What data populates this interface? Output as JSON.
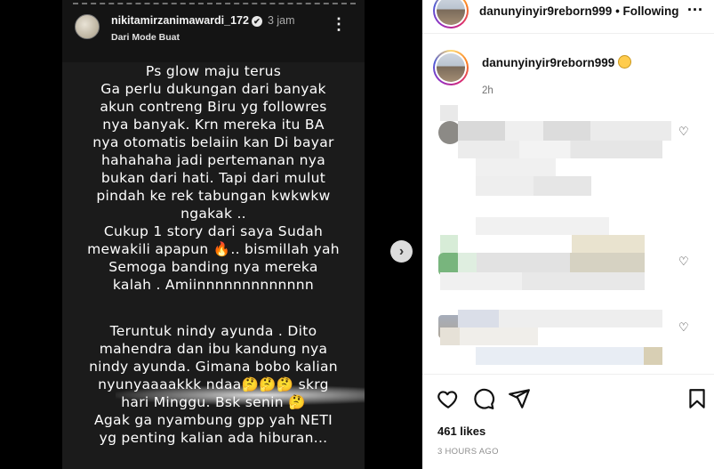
{
  "story": {
    "username": "nikitamirzanimawardi_172",
    "verified_mark": "✔",
    "time": "3 jam",
    "subtitle": "Dari Mode Buat",
    "more_icon": "more-vertical-icon",
    "text_block_1": "Ps glow maju terus\nGa perlu dukungan dari banyak\nakun contreng Biru yg followres\nnya banyak. Krn mereka itu BA\nnya otomatis belaiin kan Di bayar\nhahahaha jadi pertemanan nya\nbukan dari hati. Tapi dari mulut\npindah ke rek tabungan kwkwkw\nngakak ..\nCukup 1 story dari saya Sudah\nmewakili apapun 🔥.. bismillah yah\nSemoga banding nya mereka\nkalah . Amiinnnnnnnnnnnnn",
    "text_block_2": "Teruntuk nindy ayunda . Dito\nmahendra dan ibu kandung nya\nnindy ayunda. Gimana bobo kalian\nnyunyaaaakkk ndaa🤔🤔🤔 skrg\nhari Minggu. Bsk senin 🤔\nAgak ga nyambung gpp yah NETI\nyg penting kalian ada hiburan...",
    "next_icon": "chevron-right-icon",
    "next_glyph": "›"
  },
  "post": {
    "header": {
      "username": "danunyinyir9reborn999",
      "separator": " • ",
      "following_label": "Following",
      "more_glyph": "···"
    },
    "caption": {
      "username": "danunyinyir9reborn999",
      "emoji_icon": "grinning-squint-emoji-icon",
      "time": "2h"
    },
    "comment_heart_glyph": "♡",
    "actions": {
      "like_icon": "heart-icon",
      "comment_icon": "comment-icon",
      "share_icon": "paper-plane-icon",
      "save_icon": "bookmark-icon"
    },
    "likes": "461 likes",
    "timestamp": "3 HOURS AGO"
  },
  "colors": {
    "story_bg": "#1b1b1b",
    "panel_bg": "#ffffff",
    "muted_text": "#737373"
  }
}
